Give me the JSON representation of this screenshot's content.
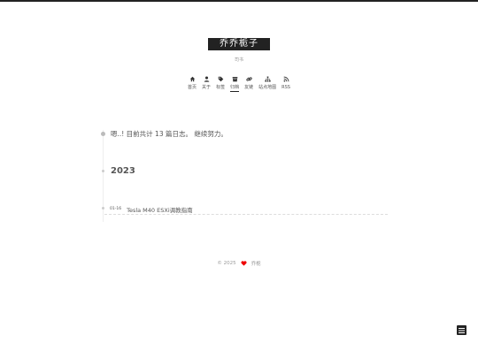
{
  "site": {
    "title": "乔乔栀子",
    "subtitle": "司书"
  },
  "nav": [
    {
      "label": "首页",
      "icon": "home-icon"
    },
    {
      "label": "关于",
      "icon": "user-icon"
    },
    {
      "label": "标签",
      "icon": "tags-icon"
    },
    {
      "label": "归档",
      "icon": "archive-icon",
      "active": true
    },
    {
      "label": "友链",
      "icon": "link-icon"
    },
    {
      "label": "站点地图",
      "icon": "sitemap-icon"
    },
    {
      "label": "RSS",
      "icon": "rss-icon"
    }
  ],
  "archive": {
    "summary": "嗯..! 目前共计 13 篇日志。 继续努力。",
    "year": "2023",
    "posts": [
      {
        "date": "01-16",
        "title": "Tesla M40 ESXi调教指南"
      }
    ]
  },
  "footer": {
    "copyright": "© 2025",
    "author": "乔栀"
  },
  "colors": {
    "dark": "#222222",
    "heart": "#ff0000"
  }
}
